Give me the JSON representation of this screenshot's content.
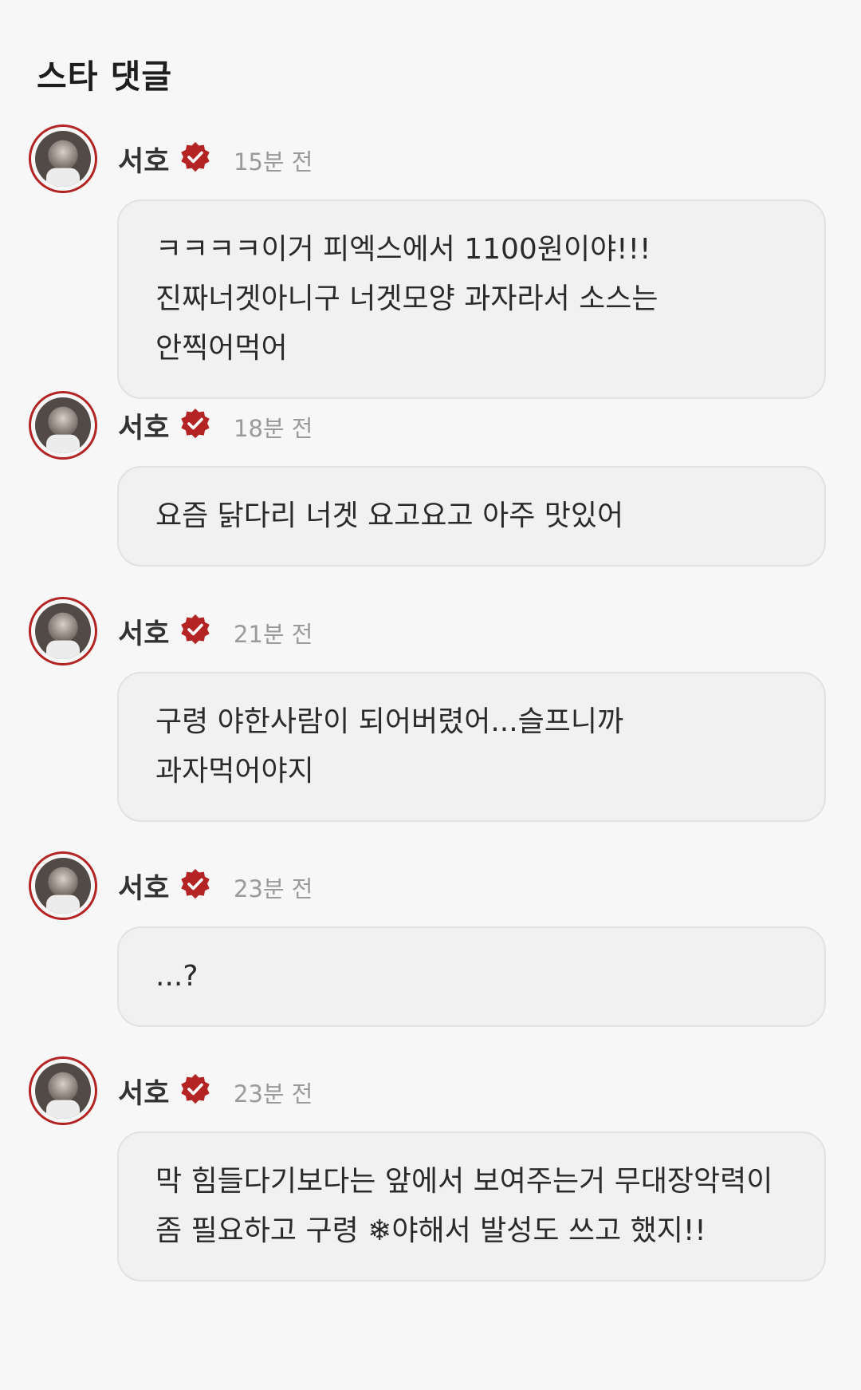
{
  "section": {
    "title": "스타 댓글"
  },
  "colors": {
    "accent": "#b42424",
    "bubble_bg": "#f1f1f1",
    "time_text": "#9a9a9a"
  },
  "comments": [
    {
      "author": "서호",
      "badge_icon": "verified-badge-icon",
      "time": "15분 전",
      "text": "ㅋㅋㅋㅋ이거 피엑스에서 1100원이야!!! 진짜너겟아니구 너겟모양 과자라서 소스는 안찍어먹어"
    },
    {
      "author": "서호",
      "badge_icon": "verified-badge-icon",
      "time": "18분 전",
      "text": "요즘 닭다리 너겟 요고요고 아주 맛있어"
    },
    {
      "author": "서호",
      "badge_icon": "verified-badge-icon",
      "time": "21분 전",
      "text": "구령 야한사람이 되어버렸어...슬프니까 과자먹어야지"
    },
    {
      "author": "서호",
      "badge_icon": "verified-badge-icon",
      "time": "23분 전",
      "text": "...?"
    },
    {
      "author": "서호",
      "badge_icon": "verified-badge-icon",
      "time": "23분 전",
      "text": "막 힘들다기보다는 앞에서 보여주는거 무대장악력이 좀 필요하고 구령 ❄야해서 발성도 쓰고 했지!!"
    }
  ]
}
